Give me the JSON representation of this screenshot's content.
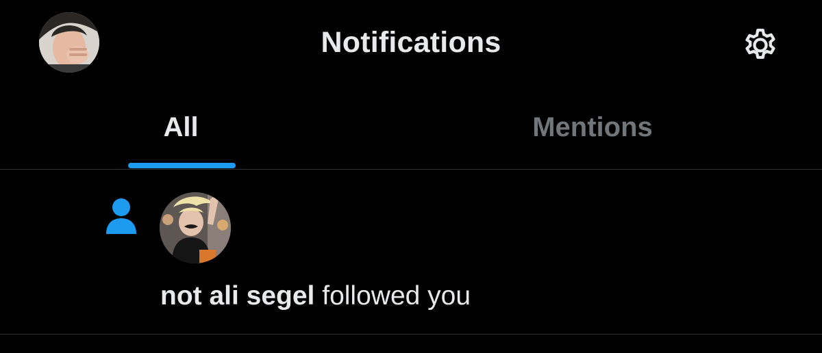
{
  "header": {
    "title": "Notifications",
    "avatar_icon": "user-avatar-photo",
    "settings_icon": "gear-icon"
  },
  "tabs": [
    {
      "label": "All",
      "active": true
    },
    {
      "label": "Mentions",
      "active": false
    }
  ],
  "notifications": [
    {
      "type_icon": "person-icon",
      "avatar_icon": "follower-avatar-photo",
      "name": "not ali segel",
      "action": " followed you"
    }
  ],
  "colors": {
    "background": "#000000",
    "accent": "#1d9bf0",
    "text_primary": "#e7e9ea",
    "text_secondary": "#71767b",
    "divider": "#2f3336"
  }
}
